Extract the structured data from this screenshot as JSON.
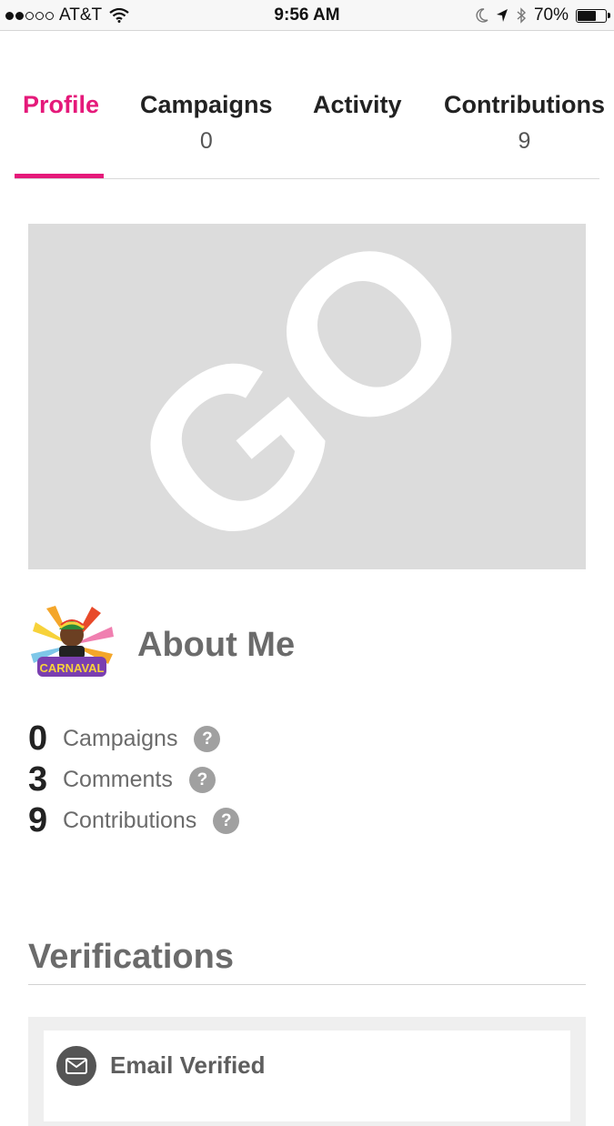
{
  "status_bar": {
    "signal_bars_filled": 2,
    "signal_bars_total": 5,
    "carrier": "AT&T",
    "time": "9:56 AM",
    "battery_percent": "70%",
    "battery_level": 0.7,
    "icons": [
      "wifi-icon",
      "moon-icon",
      "location-arrow-icon",
      "bluetooth-icon",
      "battery-icon"
    ]
  },
  "tabs": [
    {
      "label": "Profile",
      "count": "",
      "active": true
    },
    {
      "label": "Campaigns",
      "count": "0",
      "active": false
    },
    {
      "label": "Activity",
      "count": "",
      "active": false
    },
    {
      "label": "Contributions",
      "count": "9",
      "active": false
    }
  ],
  "cover": {
    "logo_text": "GO"
  },
  "about": {
    "title": "About Me",
    "avatar_text": "CARNAVAL"
  },
  "stats": [
    {
      "number": "0",
      "label": "Campaigns"
    },
    {
      "number": "3",
      "label": "Comments"
    },
    {
      "number": "9",
      "label": "Contributions"
    }
  ],
  "help_icon_text": "?",
  "verifications": {
    "title": "Verifications",
    "items": [
      {
        "label": "Email Verified",
        "icon": "envelope-icon"
      }
    ]
  },
  "colors": {
    "accent": "#e5197a",
    "cover_bg": "#dcdcdc",
    "muted_text": "#6b6b6b"
  }
}
